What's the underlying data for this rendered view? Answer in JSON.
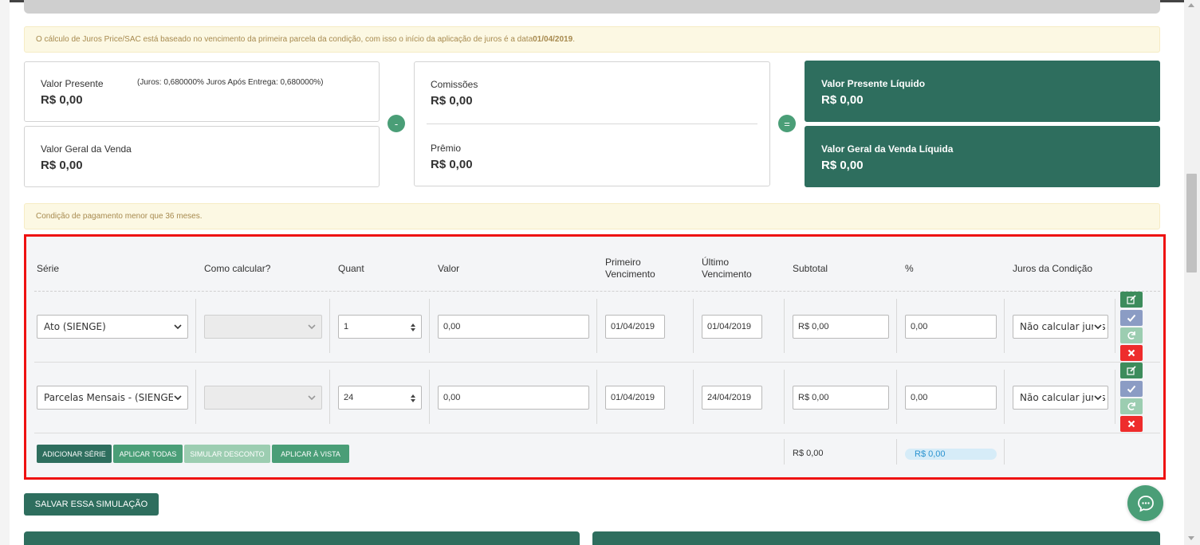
{
  "alerts": {
    "juros_text": "O cálculo de Juros Price/SAC está baseado no vencimento da primeira parcela da condição, com isso o início da aplicação de juros é a data ",
    "juros_date": "01/04/2019",
    "juros_end": ".",
    "condicao": "Condição de pagamento menor que 36 meses."
  },
  "summary": {
    "valor_presente": {
      "label": "Valor Presente",
      "value": "R$ 0,00",
      "extra": "(Juros: 0,680000%   Juros Após Entrega: 0,680000%)"
    },
    "valor_geral": {
      "label": "Valor Geral da Venda",
      "value": "R$ 0,00"
    },
    "minus": "-",
    "comissoes": {
      "label": "Comissões",
      "value": "R$ 0,00"
    },
    "premio": {
      "label": "Prêmio",
      "value": "R$ 0,00"
    },
    "equals": "=",
    "vp_liquido": {
      "label": "Valor Presente Líquido",
      "value": "R$ 0,00"
    },
    "vg_liquida": {
      "label": "Valor Geral da Venda Líquida",
      "value": "R$ 0,00"
    }
  },
  "table": {
    "headers": {
      "serie": "Série",
      "como_calcular": "Como calcular?",
      "quant": "Quant",
      "valor": "Valor",
      "primeiro_1": "Primeiro",
      "primeiro_2": "Vencimento",
      "ultimo_1": "Último",
      "ultimo_2": "Vencimento",
      "subtotal": "Subtotal",
      "percent": "%",
      "juros": "Juros da Condição"
    },
    "rows": [
      {
        "serie": "Ato (SIENGE)",
        "como_calcular": "",
        "quant": "1",
        "valor": "0,00",
        "primeiro": "01/04/2019",
        "ultimo": "01/04/2019",
        "subtotal": "R$ 0,00",
        "percent": "0,00",
        "juros": "Não calcular juros"
      },
      {
        "serie": "Parcelas Mensais - (SIENGE)",
        "como_calcular": "",
        "quant": "24",
        "valor": "0,00",
        "primeiro": "01/04/2019",
        "ultimo": "24/04/2019",
        "subtotal": "R$ 0,00",
        "percent": "0,00",
        "juros": "Não calcular juros"
      }
    ],
    "footer": {
      "adicionar": "ADICIONAR SÉRIE",
      "aplicar_todas": "APLICAR TODAS",
      "simular": "SIMULAR DESCONTO",
      "aplicar_vista": "APLICAR À VISTA",
      "total_subtotal": "R$ 0,00",
      "total_percent": "R$ 0,00"
    }
  },
  "actions": {
    "save": "SALVAR ESSA SIMULAÇÃO"
  },
  "icons": {
    "edit": "edit-icon",
    "check": "check-icon",
    "refresh": "refresh-icon",
    "delete": "close-icon",
    "chat": "chat-icon"
  },
  "colors": {
    "primary": "#2e6e5e",
    "accent": "#4a9e77",
    "danger": "#ee2c2c",
    "highlight_border": "#ee1111"
  }
}
